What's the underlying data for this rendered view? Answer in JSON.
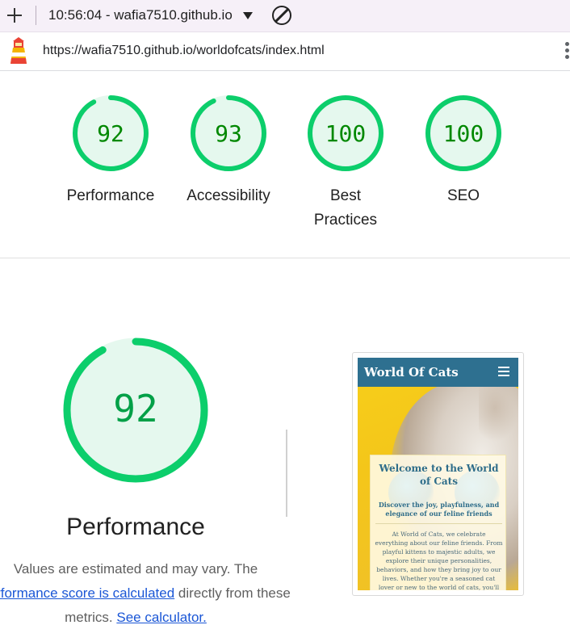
{
  "topbar": {
    "title": "10:56:04 - wafia7510.github.io",
    "icons": {
      "new": "plus-icon",
      "dropdown": "caret-down-icon",
      "clear": "block-icon"
    }
  },
  "urlbar": {
    "url": "https://wafia7510.github.io/worldofcats/index.html",
    "icons": {
      "logo": "lighthouse-icon",
      "menu": "kebab-icon"
    }
  },
  "gauges": [
    {
      "score": "92",
      "label_lines": [
        "Performance"
      ]
    },
    {
      "score": "93",
      "label_lines": [
        "Accessibility"
      ]
    },
    {
      "score": "100",
      "label_lines": [
        "Best",
        "Practices"
      ]
    },
    {
      "score": "100",
      "label_lines": [
        "SEO"
      ]
    }
  ],
  "performance": {
    "score": "92",
    "title": "Performance",
    "desc_part1": "Values are estimated and may vary. The",
    "desc_link1": "performance score is calculated",
    "desc_part2": "directly from these metrics.",
    "desc_link2": "See calculator."
  },
  "screenshot": {
    "brand": "World Of Cats",
    "heading": "Welcome to the World of Cats",
    "subheading": "Discover the joy, playfulness, and elegance of our feline friends",
    "body": "At World of Cats, we celebrate everything about our feline friends. From playful kittens to majestic adults, we explore their unique personalities, behaviors, and how they bring joy to our lives. Whether you're a seasoned cat lover or new to the world of cats, you'll"
  },
  "colors": {
    "pass_green": "#0cce6b",
    "pass_text": "#008800",
    "gauge_fill": "#e5f8ee",
    "link": "#1a56d6",
    "thumb_nav": "#2e7090"
  }
}
